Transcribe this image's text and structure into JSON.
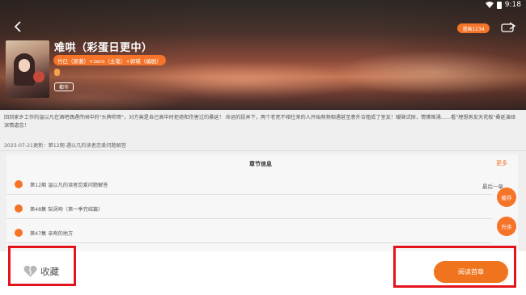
{
  "status_bar": {
    "time": "9:18"
  },
  "header": {
    "title": "难哄（彩蛋日更中）",
    "hot_badge": "漫画1234",
    "authors": "竹已（原著）+zero（主笔）+郭瑛（编剧）",
    "tag": "都市"
  },
  "description": "回到家乡工作的温以凡在酒吧偶遇传闻中的\"头牌帅哥\"，对方竟是自己高中时拒绝和伤害过的桑延！ 命运的捉弄下，两个老死不相往来的人开始频频相遇甚至意外合租成了室友！暧昧试探，情愫暗涌……看\"理想男友天花板\"桑延演绎深情虐恋！",
  "update_text": "2023-07-21更新：第12期 遇以凡的读者恋爱问题解答",
  "chapters": {
    "section_title": "章节信息",
    "more_label": "更多",
    "last_label": "最后一章",
    "items": [
      {
        "name": "第12期 温以凡的读者恋爱问题解答"
      },
      {
        "name": "第48集 梨涡吻（第一季完结篇）"
      },
      {
        "name": "第47集 亲吻的地方"
      }
    ]
  },
  "side_buttons": {
    "cache": "缓存",
    "sort": "升序"
  },
  "bottom": {
    "favorite_label": "收藏",
    "read_label": "阅读首章"
  },
  "colors": {
    "accent": "#f5742a",
    "highlight": "#e3141c"
  }
}
